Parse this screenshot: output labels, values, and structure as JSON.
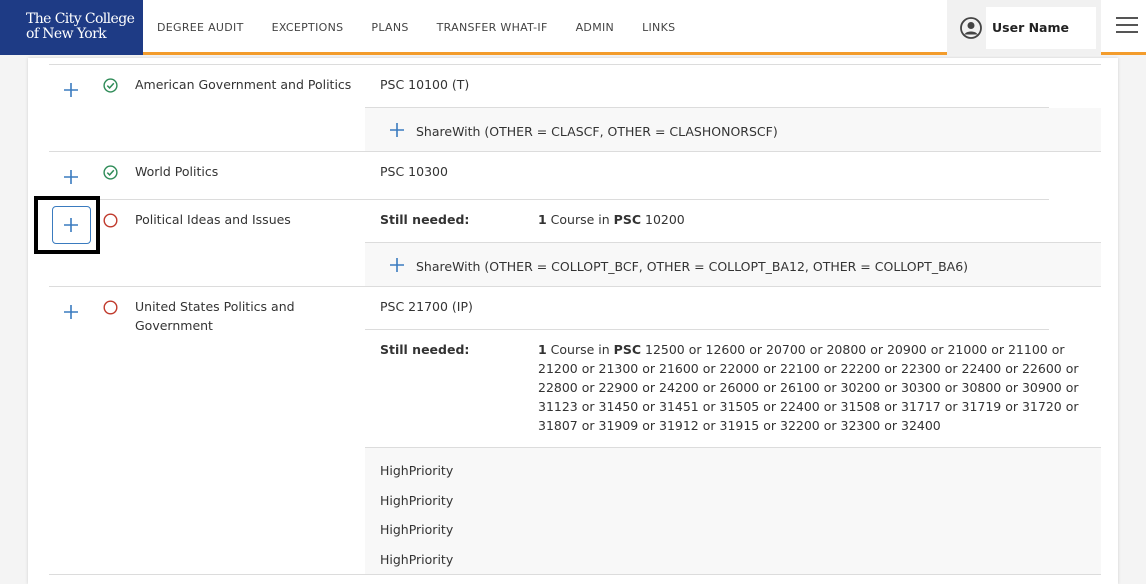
{
  "header": {
    "logo_line1": "The City College",
    "logo_line2": "of New York",
    "nav": [
      "DEGREE AUDIT",
      "EXCEPTIONS",
      "PLANS",
      "TRANSFER WHAT-IF",
      "ADMIN",
      "LINKS"
    ],
    "user_name": "User Name",
    "accent_color": "#f39c2c",
    "brand_color": "#1e3b85"
  },
  "requirements": [
    {
      "name": "American Government and Politics",
      "status": "complete",
      "course": "PSC 10100 (T)",
      "sharewith": "ShareWith (OTHER = CLASCF, OTHER = CLASHONORSCF)"
    },
    {
      "name": "World Politics",
      "status": "complete",
      "course": "PSC 10300"
    },
    {
      "name": "Political Ideas and Issues",
      "status": "incomplete",
      "still_needed_label": "Still needed:",
      "needed_count": "1",
      "needed_mid": " Course in ",
      "needed_subject": "PSC",
      "needed_courses": " 10200",
      "sharewith": "ShareWith (OTHER = COLLOPT_BCF, OTHER = COLLOPT_BA12, OTHER = COLLOPT_BA6)"
    },
    {
      "name_line1": "United States Politics and",
      "name_line2": "Government",
      "status": "incomplete",
      "course": "PSC 21700 (IP)",
      "still_needed_label": "Still needed:",
      "needed_count": "1",
      "needed_mid": " Course in ",
      "needed_subject": "PSC",
      "needed_courses": " 12500 or 12600 or 20700 or 20800 or 20900 or 21000 or 21100 or 21200 or 21300 or 21600 or 22000 or 22100 or 22200 or 22300 or 22400 or 22600 or 22800 or 22900 or 24200 or 26000 or 26100 or 30200 or 30300 or 30800 or 30900 or 31123 or 31450 or 31451 or 31505 or 22400 or 31508 or 31717 or 31719 or 31720 or 31807 or 31909 or 31912 or 31915 or 32200 or 32300 or 32400",
      "priorities": [
        "HighPriority",
        "HighPriority",
        "HighPriority",
        "HighPriority"
      ]
    }
  ],
  "colors": {
    "complete": "#2e8b57",
    "incomplete": "#c0392b",
    "plus": "#3a7bbf"
  }
}
